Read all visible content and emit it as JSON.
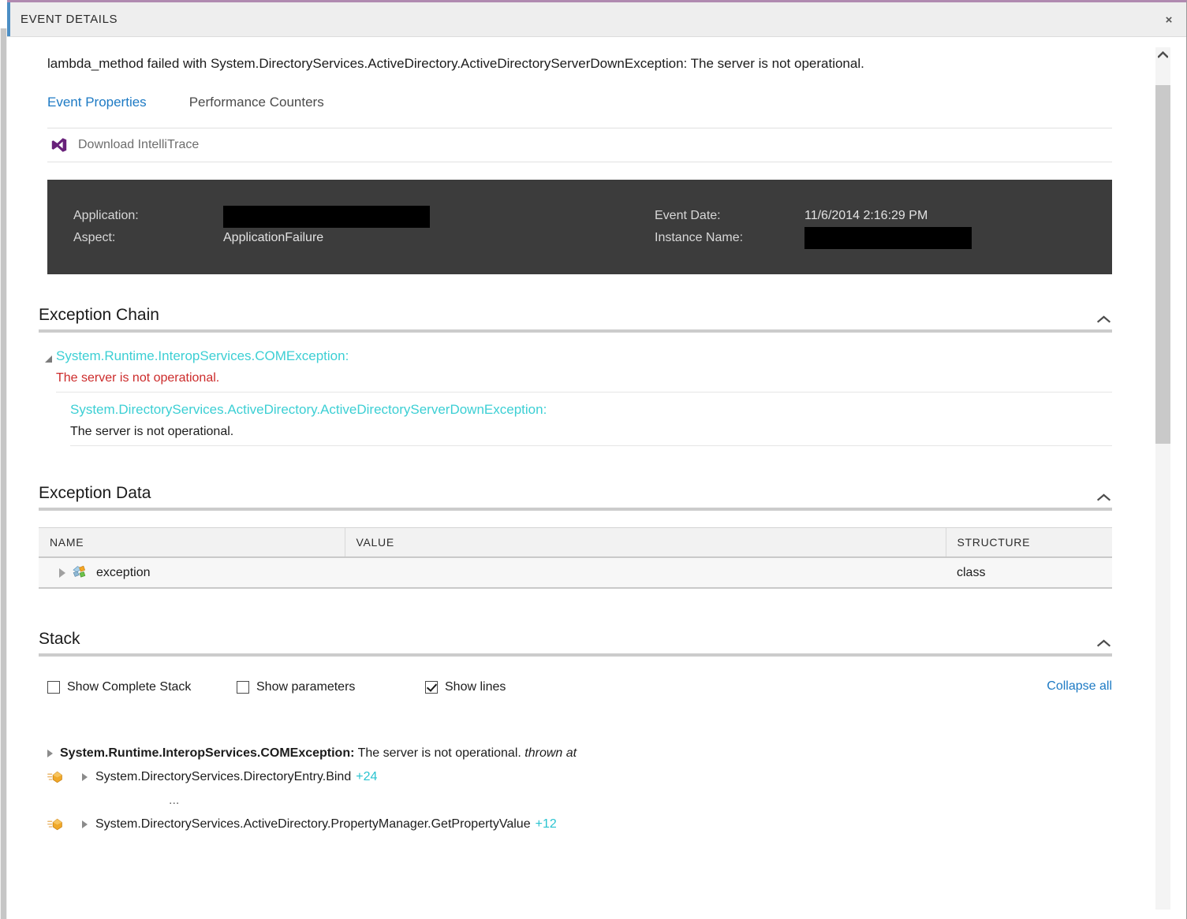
{
  "window": {
    "title": "EVENT DETAILS",
    "close_label": "×",
    "accent_color": "#4c8ec4",
    "top_border_color": "#b08ab0"
  },
  "summary": "lambda_method failed with System.DirectoryServices.ActiveDirectory.ActiveDirectoryServerDownException: The server is not operational.",
  "tabs": [
    {
      "label": "Event Properties",
      "active": true
    },
    {
      "label": "Performance Counters",
      "active": false
    }
  ],
  "intellitrace": {
    "label": "Download IntelliTrace",
    "icon": "visual-studio-icon"
  },
  "info_panel": {
    "background": "#3c3c3c",
    "left": [
      {
        "label": "Application:",
        "value": "",
        "redacted": true
      },
      {
        "label": "Aspect:",
        "value": "ApplicationFailure",
        "redacted": false
      }
    ],
    "right": [
      {
        "label": "Event Date:",
        "value": "11/6/2014 2:16:29 PM",
        "redacted": false
      },
      {
        "label": "Instance Name:",
        "value": "",
        "redacted": true
      }
    ]
  },
  "exception_chain": {
    "title": "Exception Chain",
    "collapse_icon": "chevron-up-icon",
    "outer": {
      "type": "System.Runtime.InteropServices.COMException:",
      "message": "The server is not operational.",
      "type_color": "#3ccfd4",
      "message_color": "#cc2b2b"
    },
    "inner": {
      "type": "System.DirectoryServices.ActiveDirectory.ActiveDirectoryServerDownException:",
      "message": "The server is not operational.",
      "type_color": "#3ccfd4",
      "message_color": "#1c1c1c"
    }
  },
  "exception_data": {
    "title": "Exception Data",
    "collapse_icon": "chevron-up-icon",
    "columns": [
      "NAME",
      "VALUE",
      "STRUCTURE"
    ],
    "rows": [
      {
        "name": "exception",
        "value": "",
        "structure": "class",
        "icon": "class-icon"
      }
    ]
  },
  "stack": {
    "title": "Stack",
    "collapse_icon": "chevron-up-icon",
    "options": [
      {
        "label": "Show Complete Stack",
        "checked": false
      },
      {
        "label": "Show parameters",
        "checked": false
      },
      {
        "label": "Show lines",
        "checked": true
      }
    ],
    "collapse_all_label": "Collapse all",
    "frames": [
      {
        "kind": "header",
        "type": "System.Runtime.InteropServices.COMException:",
        "message": " The server is not operational. ",
        "suffix": "thrown at"
      },
      {
        "kind": "frame",
        "name": "System.DirectoryServices.DirectoryEntry.Bind",
        "lines": "+24"
      },
      {
        "kind": "ellipsis",
        "text": "..."
      },
      {
        "kind": "frame",
        "name": "System.DirectoryServices.ActiveDirectory.PropertyManager.GetPropertyValue",
        "lines": "+12"
      }
    ]
  },
  "scrollbar": {
    "up_arrow": "⌃"
  }
}
